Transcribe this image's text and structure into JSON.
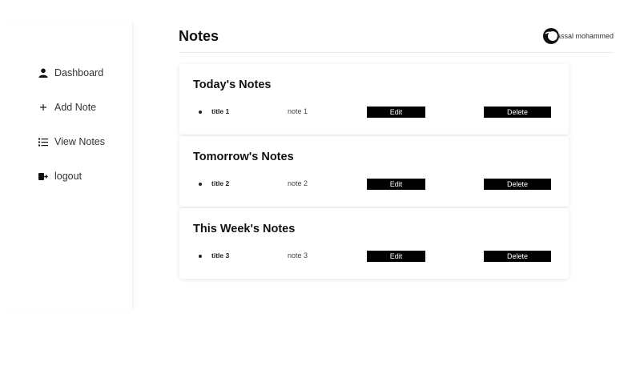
{
  "sidebar": {
    "items": [
      {
        "label": "Dashboard",
        "icon": "user-icon"
      },
      {
        "label": "Add Note",
        "icon": "plus-icon"
      },
      {
        "label": "View Notes",
        "icon": "list-icon"
      },
      {
        "label": "logout",
        "icon": "logout-icon"
      }
    ]
  },
  "header": {
    "title": "Notes",
    "user_name": "assal mohammed"
  },
  "sections": [
    {
      "title": "Today's Notes",
      "note": {
        "title": "title 1",
        "body": "note 1"
      },
      "edit_label": "Edit",
      "delete_label": "Delete"
    },
    {
      "title": "Tomorrow's Notes",
      "note": {
        "title": "title 2",
        "body": "note 2"
      },
      "edit_label": "Edit",
      "delete_label": "Delete"
    },
    {
      "title": "This Week's Notes",
      "note": {
        "title": "title 3",
        "body": "note 3"
      },
      "edit_label": "Edit",
      "delete_label": "Delete"
    }
  ],
  "colors": {
    "button_bg": "#000000",
    "button_text": "#ffffff"
  }
}
